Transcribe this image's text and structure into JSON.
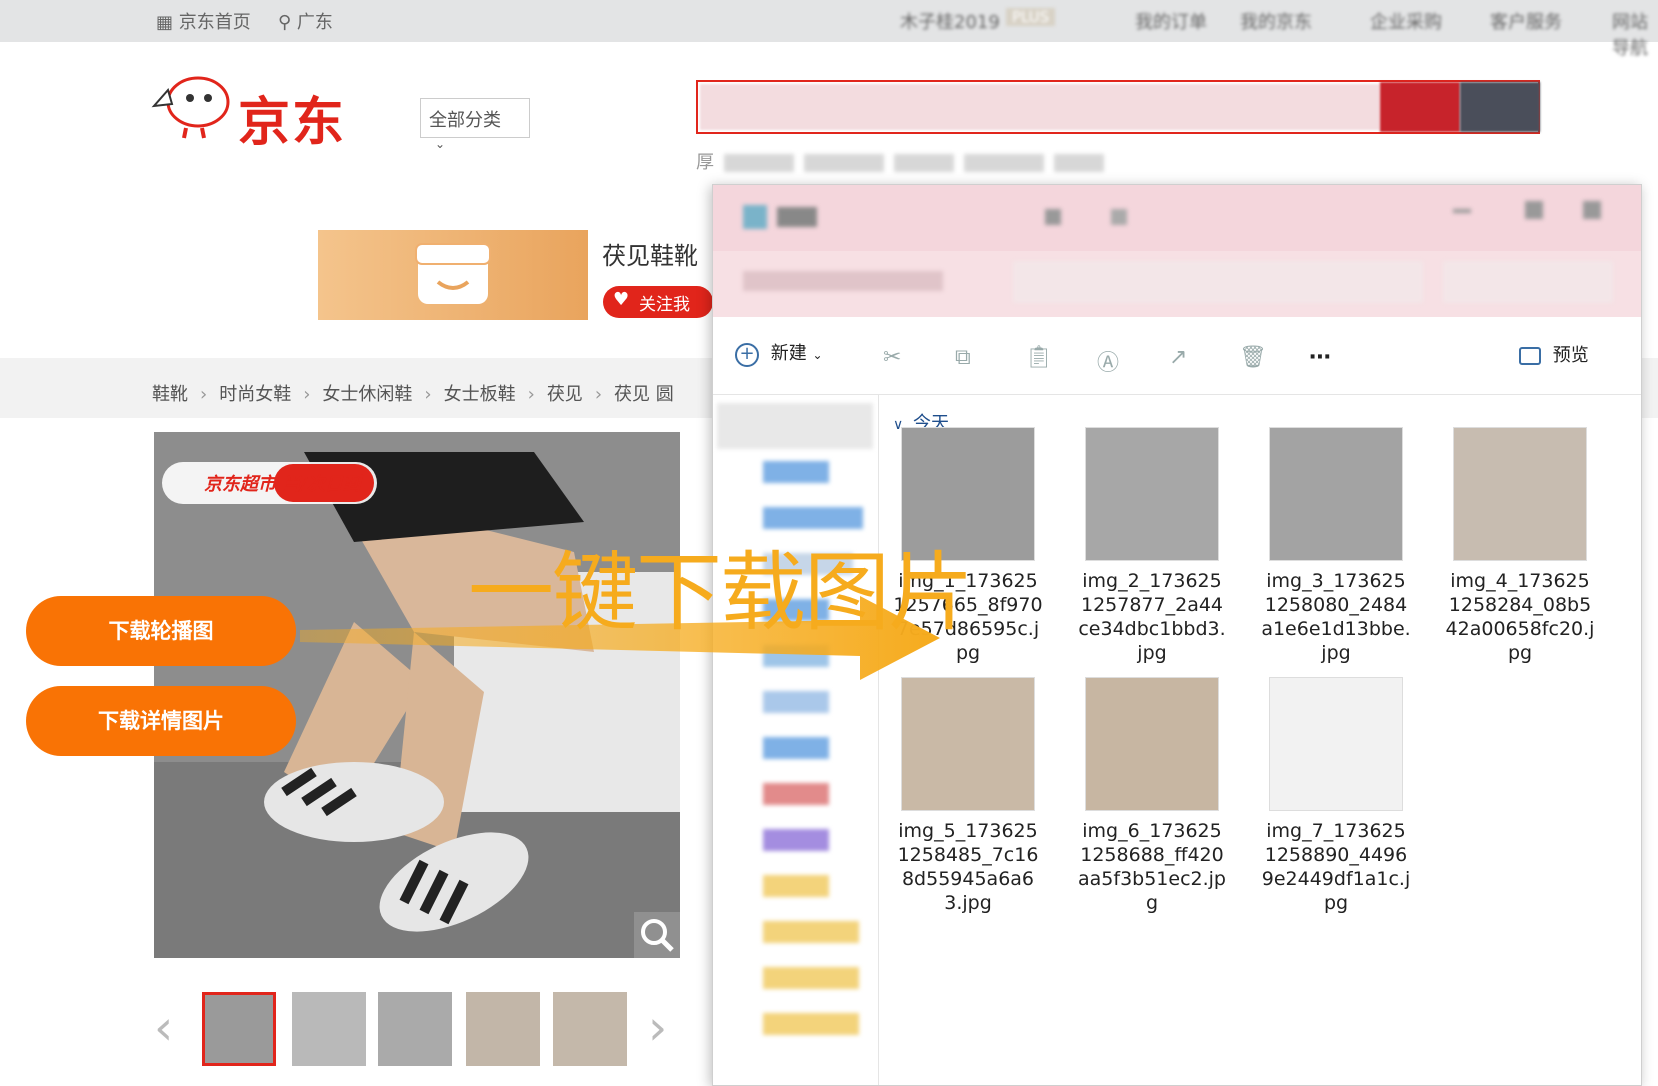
{
  "topbar": {
    "home": "京东首页",
    "location": "广东",
    "user": "木子桂2019",
    "plus": "PLUS",
    "links": [
      "我的订单",
      "我的京东",
      "企业采购",
      "客户服务",
      "网站导航"
    ]
  },
  "header": {
    "logo": "京东",
    "category": "全部分类",
    "hot_prefix": "厚"
  },
  "shop": {
    "name": "茯见鞋靴",
    "follow": "关注我"
  },
  "breadcrumb": [
    "鞋靴",
    "时尚女鞋",
    "女士休闲鞋",
    "女士板鞋",
    "茯见",
    "茯见 圆"
  ],
  "product": {
    "badge": "京东超市 当/次日到"
  },
  "buttons": {
    "carousel": "下载轮播图",
    "details": "下载详情图片"
  },
  "annotation": "一键下载图片",
  "explorer": {
    "new_label": "新建",
    "preview_label": "预览",
    "group_label": "今天",
    "files": [
      {
        "name": "img_1_1736251257665_8f9707e57d86595c.jpg"
      },
      {
        "name": "img_2_1736251257877_2a44ce34dbc1bbd3.jpg"
      },
      {
        "name": "img_3_1736251258080_2484a1e6e1d13bbe.jpg"
      },
      {
        "name": "img_4_1736251258284_08b542a00658fc20.jpg"
      },
      {
        "name": "img_5_1736251258485_7c168d55945a6a63.jpg"
      },
      {
        "name": "img_6_1736251258688_ff420aa5f3b51ec2.jpg"
      },
      {
        "name": "img_7_1736251258890_44969e2449df1a1c.jpg"
      }
    ]
  },
  "colors": {
    "jd_red": "#e1251b",
    "orange": "#f97305",
    "annotation": "#f6ab1d"
  }
}
